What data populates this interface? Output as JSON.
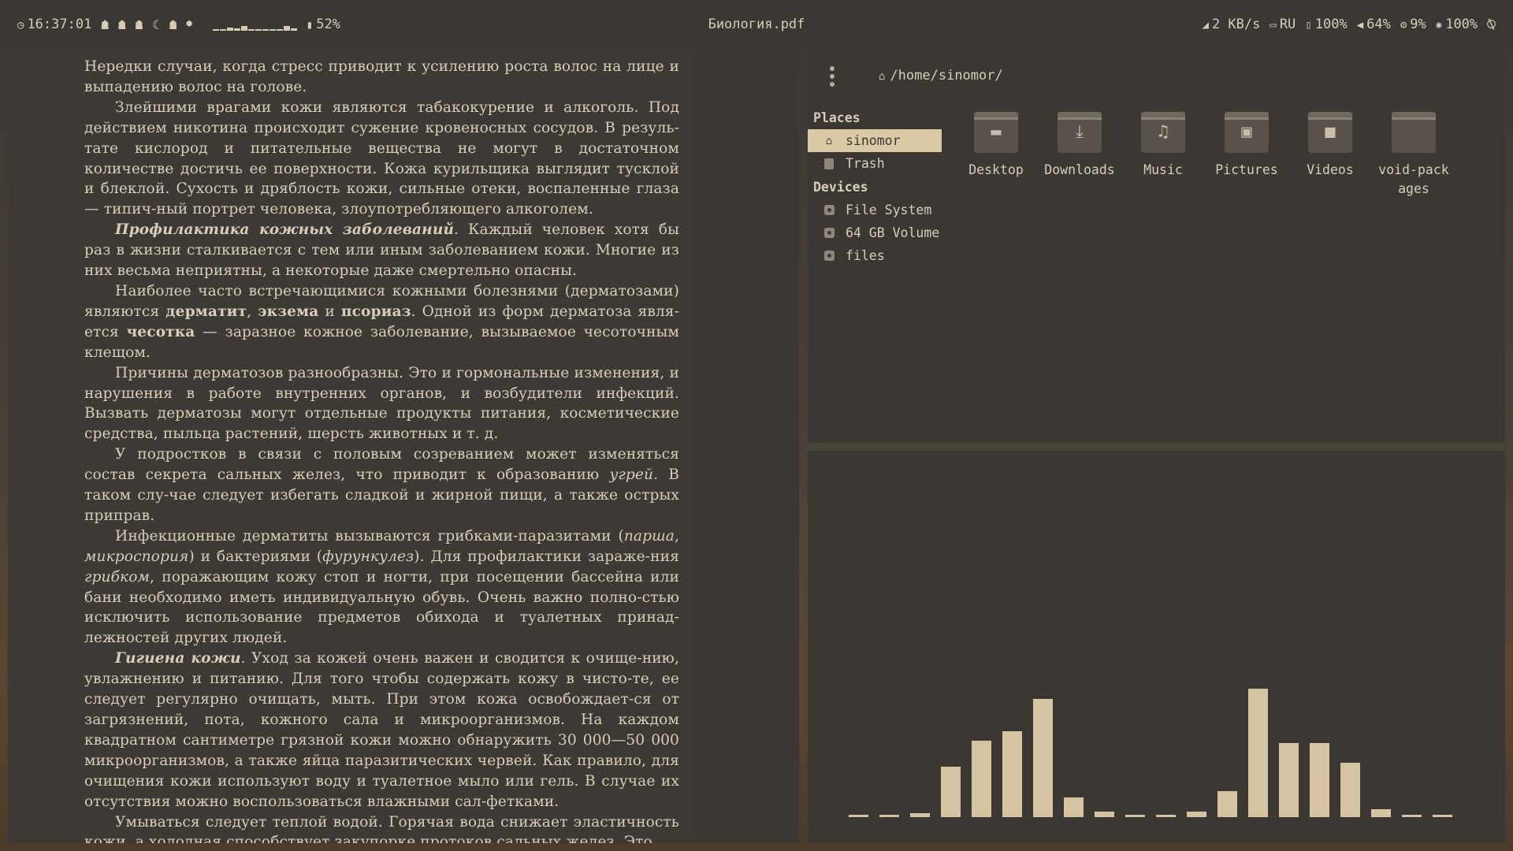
{
  "topbar": {
    "clock": "16:37:01",
    "workspace_icons": [
      "ghost-icon",
      "ghost-icon",
      "ghost-icon",
      "moon-icon",
      "ghost-icon",
      "dot-icon"
    ],
    "cpu_sparkline": [
      0.05,
      0.05,
      0.25,
      0.2,
      0.35,
      0.15,
      0.05,
      0.05,
      0.05,
      0.05,
      0.4,
      0.2
    ],
    "battery_label": "52%",
    "window_title": "Биология.pdf",
    "network": "2 KB/s",
    "layout": "RU",
    "battery2": "100%",
    "volume": "64%",
    "cpu": "9%",
    "brightness": "100%",
    "colors": {
      "bar_bg": "#3b3833",
      "text": "#d6ccb8"
    }
  },
  "pdf": {
    "paragraphs": [
      {
        "indent": false,
        "html": "Нередки случаи, когда стресс приводит к усилению роста волос на лице и выпадению волос на голове."
      },
      {
        "indent": true,
        "html": "Злейшими врагами кожи являются табакокурение и алкоголь. Под действием никотина происходит сужение кровеносных сосудов. В резуль-тате кислород и питательные вещества не могут в достаточном количестве достичь ее поверхности. Кожа курильщика выглядит тусклой и блеклой. Сухость и дряблость кожи, сильные отеки, воспаленные глаза — типич-ный портрет человека, злоупотребляющего алкоголем."
      },
      {
        "indent": true,
        "html": "<b><i>Профилактика кожных заболеваний</i></b>. Каждый человек хотя бы раз в жизни сталкивается с тем или иным заболеванием кожи. Многие из них весьма неприятны, а некоторые даже смертельно опасны."
      },
      {
        "indent": true,
        "html": "Наиболее часто встречающимися кожными болезнями (дерматозами) являются <b>дерматит</b>, <b>экзема</b> и <b>псориаз</b>. Одной из форм дерматоза явля-ется <b>чесотка</b> — заразное кожное заболевание, вызываемое чесоточным клещом."
      },
      {
        "indent": true,
        "html": "Причины дерматозов разнообразны. Это и гормональные изменения, и нарушения в работе внутренних органов, и возбудители инфекций. Вызвать дерматозы могут отдельные продукты питания, косметические средства, пыльца растений, шерсть животных и т. д."
      },
      {
        "indent": true,
        "html": "У подростков в связи с половым созреванием может изменяться состав секрета сальных желез, что приводит к образованию <i>угрей</i>. В таком слу-чае следует избегать сладкой и жирной пищи, а также острых приправ."
      },
      {
        "indent": true,
        "html": "Инфекционные дерматиты вызываются грибками-паразитами (<i>парша</i>, <i>микроспория</i>) и бактериями (<i>фурункулез</i>). Для профилактики зараже-ния <i>грибком</i>, поражающим кожу стоп и ногти, при посещении бассейна или бани необходимо иметь индивидуальную обувь. Очень важно полно-стью исключить использование предметов обихода и туалетных принад-лежностей других людей."
      },
      {
        "indent": true,
        "html": "<b><i>Гигиена кожи</i></b>. Уход за кожей очень важен и сводится к очище-нию, увлажнению и питанию. Для того чтобы содержать кожу в чисто-те, ее следует регулярно очищать, мыть. При этом кожа освобождает-ся от загрязнений, пота, кожного сала и микроорганизмов. На каждом квадратном сантиметре грязной кожи можно обнаружить 30 000—50 000 микроорганизмов, а также яйца паразитических червей. Как правило, для очищения кожи используют воду и туалетное мыло или гель. В случае их отсутствия можно воспользоваться влажными сал-фетками."
      },
      {
        "indent": true,
        "html": "Умываться следует теплой водой. Горячая вода снижает эластичность кожи, а холодная способствует закупорке протоков сальных желез. Это"
      }
    ]
  },
  "filemanager": {
    "path": "/home/sinomor/",
    "places_title": "Places",
    "places": [
      {
        "label": "sinomor",
        "icon": "home-icon",
        "selected": true
      },
      {
        "label": "Trash",
        "icon": "trash-icon",
        "selected": false
      }
    ],
    "devices_title": "Devices",
    "devices": [
      {
        "label": "File System",
        "icon": "disk-icon"
      },
      {
        "label": "64 GB Volume",
        "icon": "disk-icon"
      },
      {
        "label": "files",
        "icon": "disk-icon"
      }
    ],
    "folders": [
      {
        "label": "Desktop",
        "icon": "desktop-icon",
        "glyph": "▬"
      },
      {
        "label": "Downloads",
        "icon": "download-icon",
        "glyph": "⤓"
      },
      {
        "label": "Music",
        "icon": "music-icon",
        "glyph": "♫"
      },
      {
        "label": "Pictures",
        "icon": "picture-icon",
        "glyph": "▣"
      },
      {
        "label": "Videos",
        "icon": "video-icon",
        "glyph": "■"
      },
      {
        "label": "void-packages",
        "icon": "folder-icon",
        "glyph": ""
      }
    ]
  },
  "visualizer": {
    "bar_color": "#d5c4a1",
    "levels": [
      0.02,
      0.02,
      0.03,
      0.39,
      0.59,
      0.66,
      0.91,
      0.15,
      0.04,
      0.02,
      0.02,
      0.04,
      0.2,
      0.99,
      0.57,
      0.57,
      0.42,
      0.06,
      0.02,
      0.02
    ]
  }
}
